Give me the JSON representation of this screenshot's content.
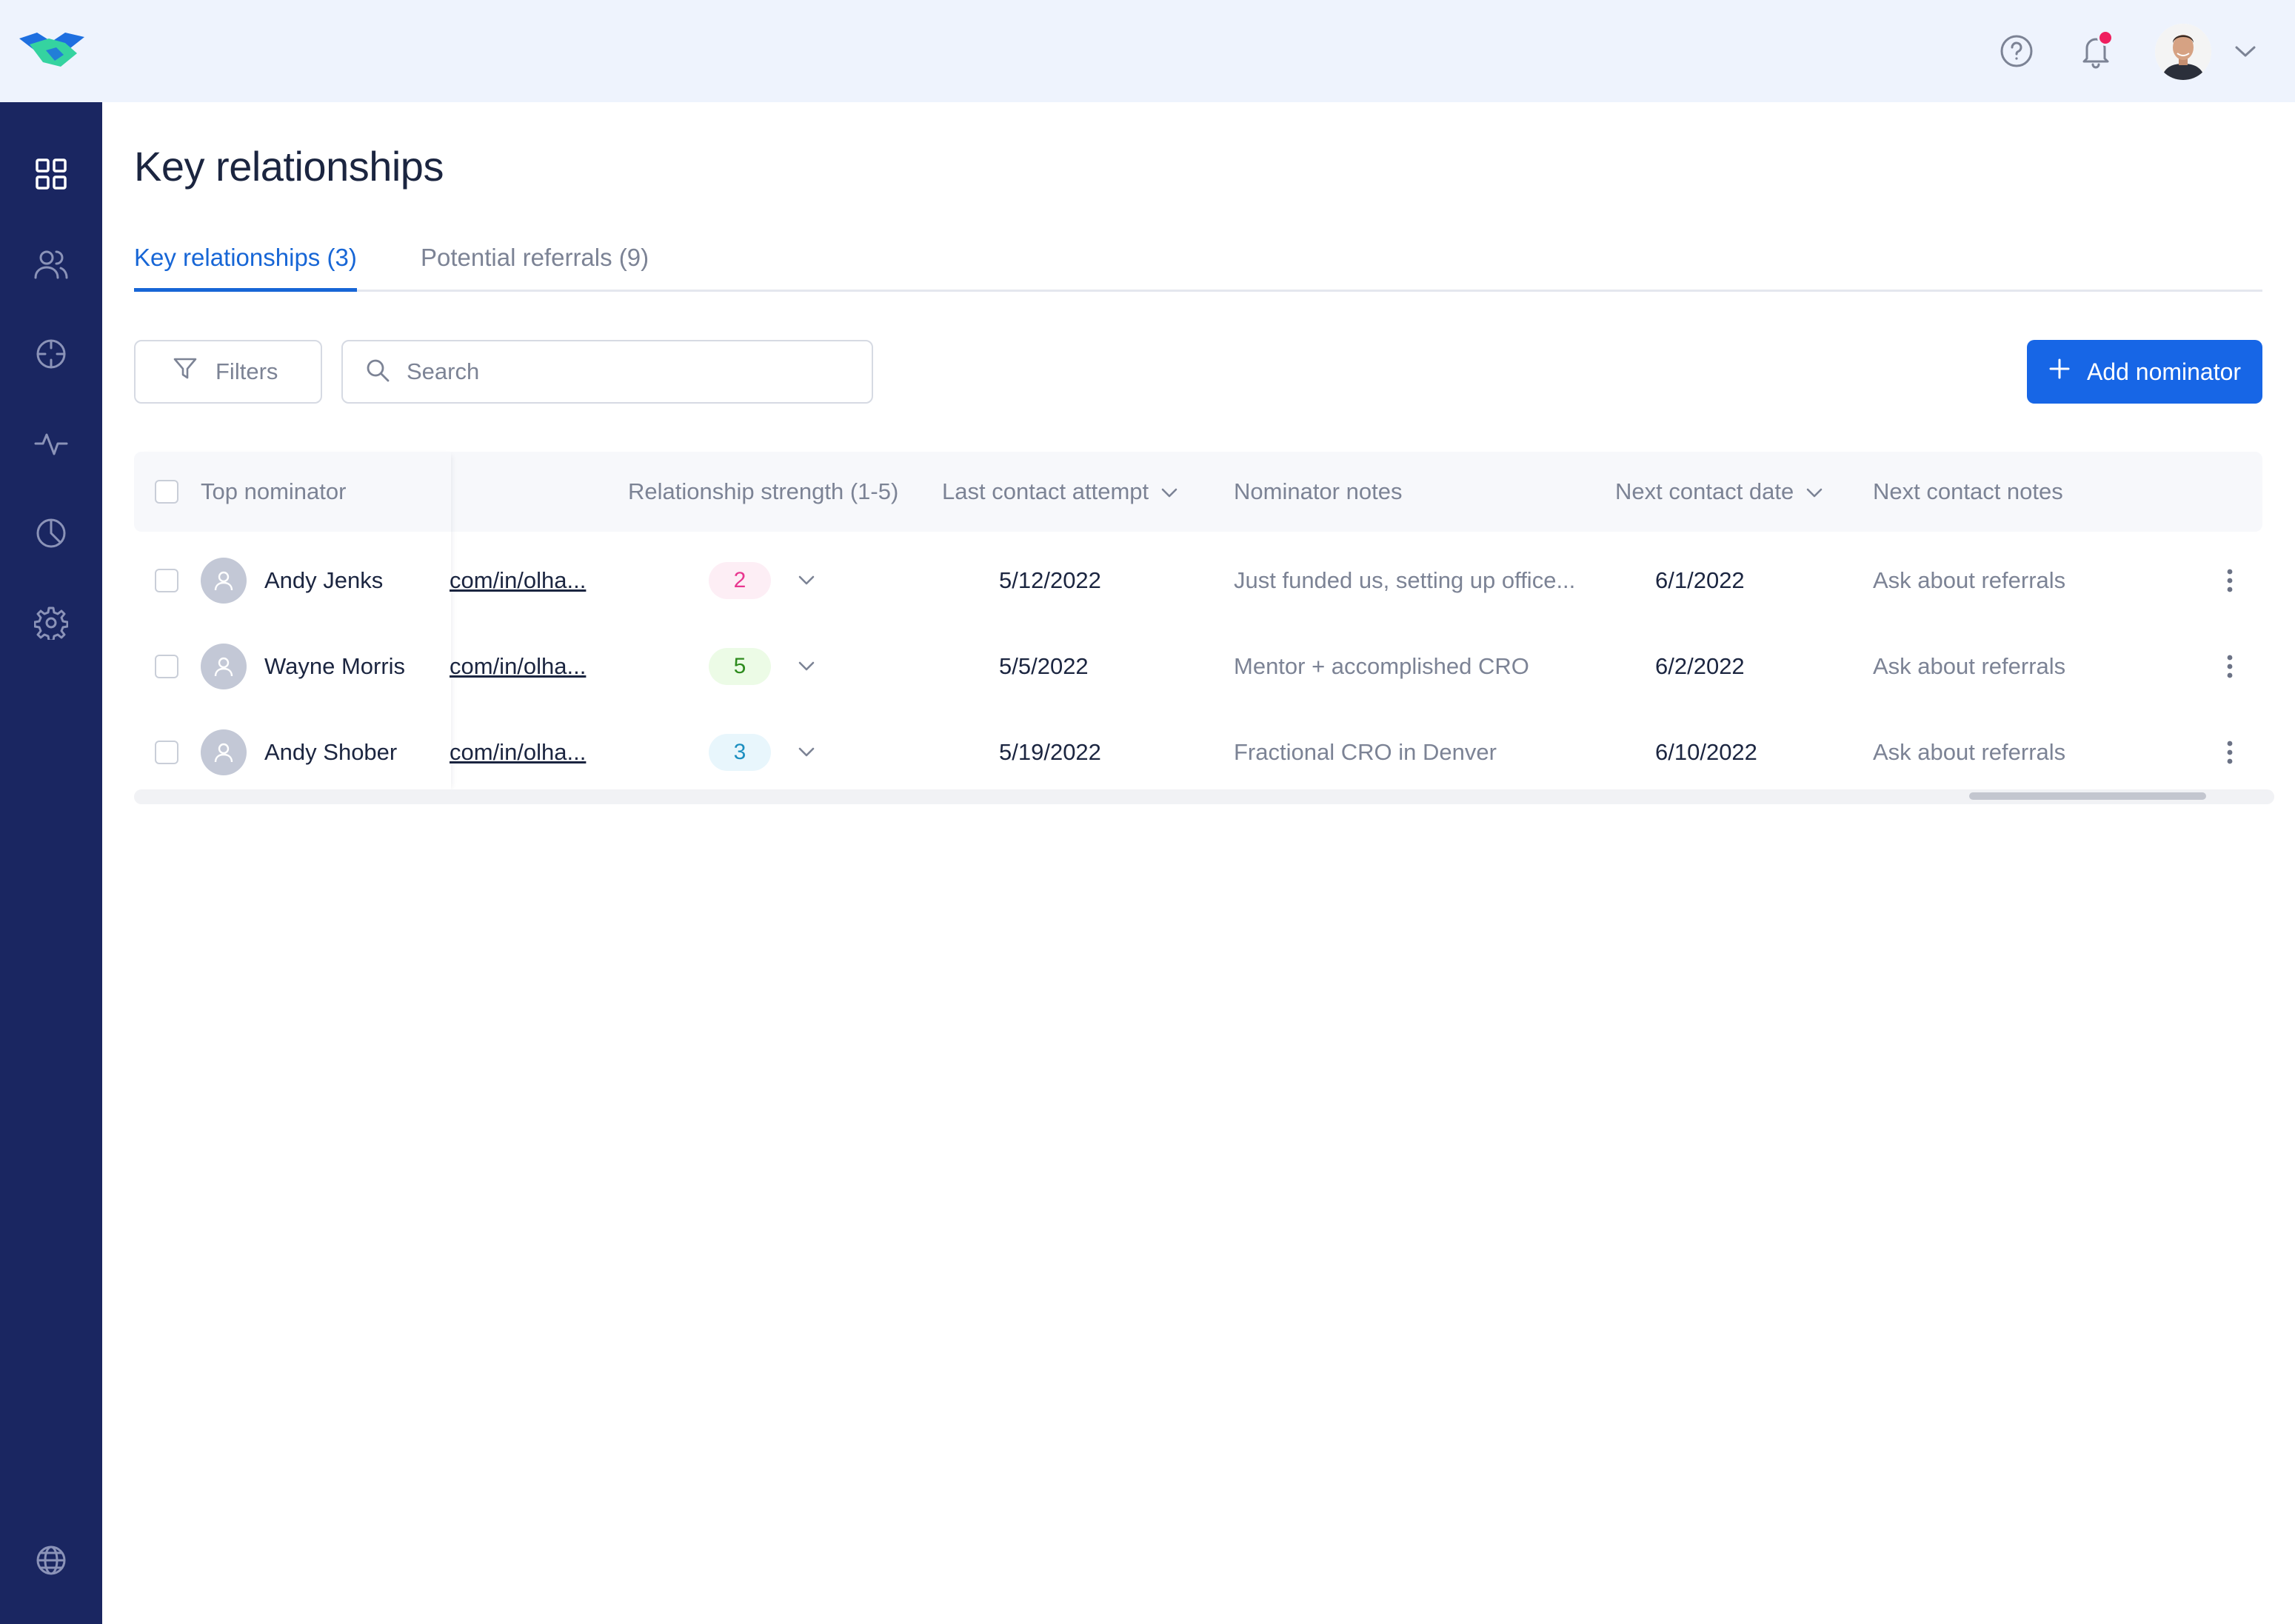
{
  "app": {
    "logo_icon": "handshake-logo"
  },
  "topbar": {
    "help_icon": "help-circle-icon",
    "notification_icon": "bell-icon",
    "notification_dot_color": "#ef1f5f",
    "user_menu_icon": "chevron-down-icon"
  },
  "sidebar": {
    "items": [
      {
        "icon": "dashboard-grid-icon",
        "active": true
      },
      {
        "icon": "users-icon"
      },
      {
        "icon": "crosshair-icon"
      },
      {
        "icon": "activity-icon"
      },
      {
        "icon": "pie-chart-icon"
      },
      {
        "icon": "settings-gear-icon"
      }
    ],
    "bottom_icon": "globe-icon"
  },
  "page": {
    "title": "Key relationships"
  },
  "tabs": [
    {
      "label": "Key relationships (3)",
      "active": true
    },
    {
      "label": "Potential referrals (9)",
      "active": false
    }
  ],
  "toolbar": {
    "filters_label": "Filters",
    "search_placeholder": "Search",
    "search_value": "",
    "add_label": "Add nominator"
  },
  "table": {
    "columns": {
      "top_nominator": "Top nominator",
      "relationship_strength": "Relationship strength (1-5)",
      "last_contact_attempt": "Last contact attempt",
      "nominator_notes": "Nominator notes",
      "next_contact_date": "Next contact date",
      "next_contact_notes": "Next contact notes"
    },
    "rows": [
      {
        "name": "Andy Jenks",
        "link": "com/in/olha...",
        "strength": "2",
        "strength_color": "#e8368f",
        "strength_bg": "#fdeef5",
        "last_contact": "5/12/2022",
        "notes": "Just funded us, setting up office...",
        "next_date": "6/1/2022",
        "next_notes": "Ask about referrals"
      },
      {
        "name": "Wayne Morris",
        "link": "com/in/olha...",
        "strength": "5",
        "strength_color": "#2e8b1e",
        "strength_bg": "#ecfbe6",
        "last_contact": "5/5/2022",
        "notes": "Mentor + accomplished CRO",
        "next_date": "6/2/2022",
        "next_notes": "Ask about referrals"
      },
      {
        "name": "Andy Shober",
        "link": "com/in/olha...",
        "strength": "3",
        "strength_color": "#1c8fc0",
        "strength_bg": "#e8f6fc",
        "last_contact": "5/19/2022",
        "notes": "Fractional CRO in Denver",
        "next_date": "6/10/2022",
        "next_notes": "Ask about referrals"
      }
    ]
  },
  "colors": {
    "accent": "#1766e6",
    "sidebar": "#1a2661",
    "topbar": "#eef3fd"
  }
}
